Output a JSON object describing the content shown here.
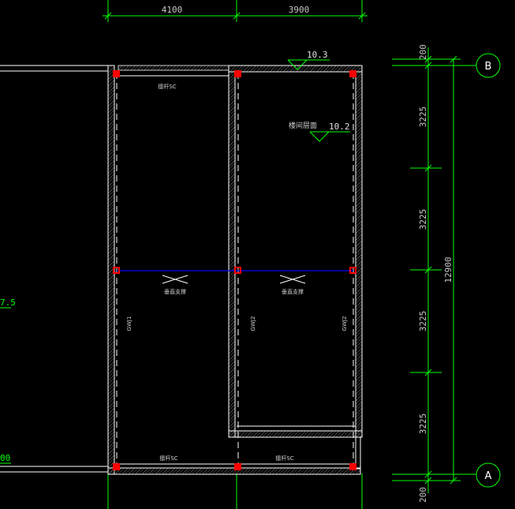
{
  "dimensions": {
    "top": [
      "4100",
      "3900"
    ],
    "right_segments": [
      "200",
      "3225",
      "3225",
      "3225",
      "3225",
      "200"
    ],
    "right_total": "12900"
  },
  "axes": {
    "top": "B",
    "bottom": "A"
  },
  "elevations": {
    "roof_top": "10.3",
    "roof_stair": "10.2",
    "stair_label": "楼间层面"
  },
  "labels": {
    "top_beam_left": "檩杆SC",
    "bottom_beam_left": "檩杆SC",
    "bottom_beam_right": "檩杆SC",
    "brace_left": "垂直支撑",
    "brace_right": "垂直支撑",
    "col_1": "GWJ1",
    "col_2": "GWJ2",
    "col_3": "GWJ2"
  },
  "edge_text": {
    "left_mid": "7.5",
    "left_bottom": "00"
  },
  "colors": {
    "bg": "#000000",
    "dim_green": "#00ff00",
    "white": "#ffffff",
    "red": "#ff0000",
    "blue": "#0000ff",
    "hatch": "#9a9a9a"
  }
}
